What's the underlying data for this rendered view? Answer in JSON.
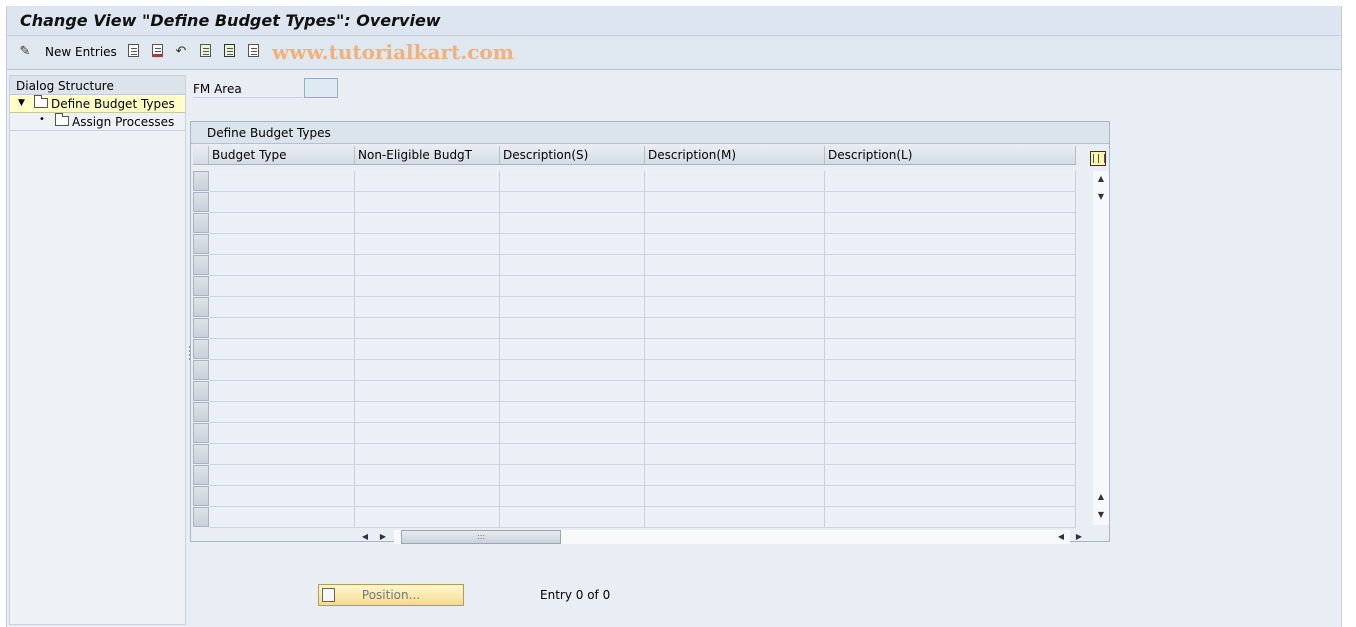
{
  "window": {
    "title": "Change View \"Define Budget Types\": Overview"
  },
  "toolbar": {
    "new_entries_label": "New Entries",
    "watermark": "www.tutorialkart.com",
    "icons": [
      "toggle-change-icon",
      "copy-icon",
      "delete-icon",
      "undo-icon",
      "select-all-icon",
      "select-block-icon",
      "deselect-all-icon"
    ]
  },
  "dialog_structure": {
    "header": "Dialog Structure",
    "items": [
      {
        "label": "Define Budget Types",
        "selected": true,
        "expanded": true
      },
      {
        "label": "Assign Processes",
        "selected": false
      }
    ]
  },
  "filter": {
    "fm_area_label": "FM Area",
    "fm_area_value": ""
  },
  "table": {
    "title": "Define Budget Types",
    "columns": [
      "Budget Type",
      "Non-Eligible BudgT",
      "Description(S)",
      "Description(M)",
      "Description(L)"
    ],
    "empty_rows": 17,
    "rows": []
  },
  "footer": {
    "position_button_label": "Position...",
    "entry_text": "Entry 0 of 0"
  },
  "colors": {
    "accent": "#dde6f0",
    "selected_tree_item": "#ffffc8",
    "watermark": "#f0b27a",
    "position_button": "#f1dc8f"
  }
}
